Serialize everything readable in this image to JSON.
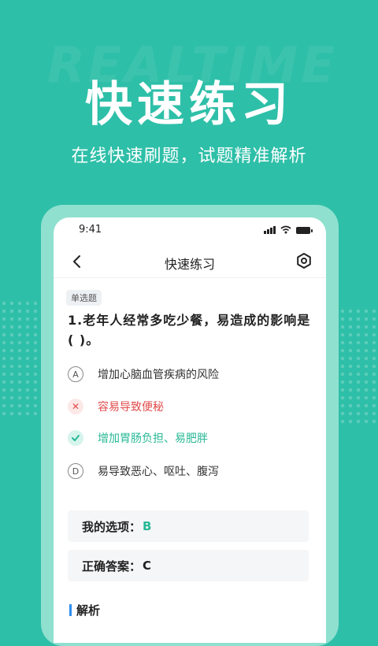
{
  "watermark": "REALTIME",
  "hero": {
    "title": "快速练习",
    "subtitle": "在线快速刷题，试题精准解析"
  },
  "status_bar": {
    "time": "9:41"
  },
  "nav": {
    "title": "快速练习",
    "back_icon": "chevron-left-icon",
    "settings_icon": "hexagon-settings-icon"
  },
  "question": {
    "type": "单选题",
    "text": "1.老年人经常多吃少餐，易造成的影响是(    )。",
    "options": [
      {
        "mark": "A",
        "label": "增加心脑血管疾病的风险",
        "state": "normal"
      },
      {
        "mark": "✕",
        "label": "容易导致便秘",
        "state": "wrong"
      },
      {
        "mark": "✓",
        "label": "增加胃肠负担、易肥胖",
        "state": "correct"
      },
      {
        "mark": "D",
        "label": "易导致恶心、呕吐、腹泻",
        "state": "normal"
      }
    ]
  },
  "answers": {
    "mine_label": "我的选项：",
    "mine_value": "B",
    "correct_label": "正确答案：",
    "correct_value": "C"
  },
  "analysis": {
    "label": "解析"
  },
  "colors": {
    "background": "#2ebfa8",
    "accent_green": "#27b896",
    "wrong_red": "#e24b4b",
    "analysis_blue": "#2e8df0"
  }
}
